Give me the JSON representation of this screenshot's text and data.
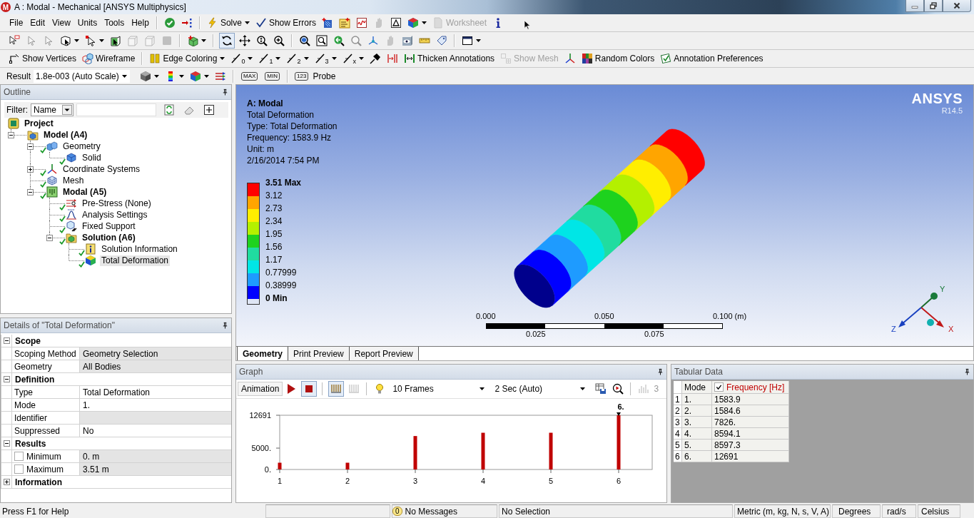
{
  "window": {
    "icon_label": "M",
    "title": "A : Modal - Mechanical [ANSYS Multiphysics]"
  },
  "menu": [
    "File",
    "Edit",
    "View",
    "Units",
    "Tools",
    "Help"
  ],
  "toolbar_1": [
    {
      "disabled": false
    },
    {
      "disabled": false
    },
    {
      "label": "Solve",
      "disabled": false
    },
    {
      "label": "Show Errors",
      "disabled": false
    },
    {
      "disabled": false
    },
    {
      "disabled": false
    },
    {
      "disabled": false
    },
    {
      "disabled": true
    },
    {
      "disabled": false
    },
    {
      "disabled": false
    },
    {
      "label": "Worksheet",
      "disabled": true
    },
    {
      "disabled": false
    }
  ],
  "toolbar_2": [
    {
      "disabled": false,
      "pressed": false
    },
    {
      "disabled": true,
      "pressed": false
    },
    {
      "disabled": true,
      "pressed": false
    },
    {
      "disabled": false,
      "pressed": false
    },
    {
      "disabled": false,
      "pressed": false
    },
    {
      "disabled": false,
      "pressed": false
    },
    {
      "disabled": true,
      "pressed": false
    },
    {
      "disabled": true,
      "pressed": false
    },
    {
      "disabled": true,
      "pressed": false
    },
    {
      "disabled": false,
      "pressed": false
    },
    {
      "disabled": false,
      "pressed": true
    },
    {
      "disabled": false,
      "pressed": false
    },
    {
      "disabled": false,
      "pressed": false
    },
    {
      "disabled": false,
      "pressed": false
    },
    {
      "disabled": false,
      "pressed": false
    },
    {
      "disabled": false,
      "pressed": false
    },
    {
      "disabled": false,
      "pressed": false
    },
    {
      "disabled": true,
      "pressed": false
    },
    {
      "disabled": false,
      "pressed": false
    },
    {
      "disabled": true,
      "pressed": false
    },
    {
      "disabled": false,
      "pressed": false
    },
    {
      "disabled": false,
      "pressed": false
    },
    {
      "disabled": false,
      "pressed": false
    },
    {
      "disabled": false,
      "pressed": false
    }
  ],
  "toolbar_3": [
    {
      "label": "Show Vertices",
      "disabled": false
    },
    {
      "label": "Wireframe",
      "disabled": false
    },
    {
      "label": "Edge Coloring",
      "disabled": false
    },
    {
      "label": "0",
      "disabled": false
    },
    {
      "label": "1",
      "disabled": false
    },
    {
      "label": "2",
      "disabled": false
    },
    {
      "label": "3",
      "disabled": false
    },
    {
      "label": "x",
      "disabled": false
    },
    {
      "disabled": false
    },
    {
      "disabled": false
    },
    {
      "label": "Thicken Annotations",
      "disabled": false
    },
    {
      "label": "Show Mesh",
      "disabled": true
    },
    {
      "disabled": false
    },
    {
      "label": "Random Colors",
      "disabled": false
    },
    {
      "label": "Annotation Preferences",
      "disabled": false
    }
  ],
  "result_toolbar": {
    "label": "Result",
    "scale": "1.8e-003 (Auto Scale)",
    "buttons": [
      {
        "disabled": false
      },
      {
        "disabled": false
      },
      {
        "disabled": false
      },
      {
        "disabled": false
      }
    ],
    "max": "MAX",
    "min": "MIN",
    "probe_badge": "123",
    "probe": "Probe"
  },
  "outline": {
    "title": "Outline",
    "filter_label": "Filter:",
    "filter_value": "Name",
    "tree": [
      {
        "label": "Project",
        "kind": "project",
        "ok": false,
        "selected": false,
        "children": [
          {
            "label": "Model (A4)",
            "kind": "model",
            "expanded": true,
            "ok": false,
            "selected": false,
            "children": [
              {
                "label": "Geometry",
                "kind": "geometry",
                "expanded": true,
                "ok": true,
                "selected": false,
                "children": [
                  {
                    "label": "Solid",
                    "kind": "body",
                    "ok": true,
                    "selected": false
                  }
                ]
              },
              {
                "label": "Coordinate Systems",
                "kind": "coordinates",
                "expanded": false,
                "ok": true,
                "selected": false
              },
              {
                "label": "Mesh",
                "kind": "mesh",
                "ok": true,
                "selected": false
              },
              {
                "label": "Modal (A5)",
                "kind": "analysis",
                "expanded": true,
                "ok": true,
                "selected": false,
                "children": [
                  {
                    "label": "Pre-Stress (None)",
                    "kind": "prestress",
                    "ok": true,
                    "selected": false
                  },
                  {
                    "label": "Analysis Settings",
                    "kind": "settings",
                    "ok": true,
                    "selected": false
                  },
                  {
                    "label": "Fixed Support",
                    "kind": "support",
                    "ok": true,
                    "selected": false
                  },
                  {
                    "label": "Solution (A6)",
                    "kind": "solution",
                    "expanded": true,
                    "ok": true,
                    "selected": false,
                    "children": [
                      {
                        "label": "Solution Information",
                        "kind": "info",
                        "ok": true,
                        "selected": false
                      },
                      {
                        "label": "Total Deformation",
                        "kind": "result",
                        "ok": true,
                        "selected": true
                      }
                    ]
                  }
                ]
              }
            ]
          }
        ]
      }
    ]
  },
  "details": {
    "title": "Details of \"Total Deformation\"",
    "groups": [
      {
        "label": "Scope",
        "expanded": true,
        "rows": [
          {
            "name": "Scoping Method",
            "value": "Geometry Selection",
            "readonly": true
          },
          {
            "name": "Geometry",
            "value": "All Bodies",
            "readonly": true
          }
        ]
      },
      {
        "label": "Definition",
        "expanded": true,
        "rows": [
          {
            "name": "Type",
            "value": "Total Deformation",
            "readonly": false
          },
          {
            "name": "Mode",
            "value": "1.",
            "readonly": false
          },
          {
            "name": "Identifier",
            "readonly": true
          },
          {
            "name": "Suppressed",
            "value": "No",
            "readonly": false
          }
        ]
      },
      {
        "label": "Results",
        "expanded": true,
        "rows": [
          {
            "name": "Minimum",
            "value": "0. m",
            "readonly": true,
            "checked": false
          },
          {
            "name": "Maximum",
            "value": "3.51 m",
            "readonly": true,
            "checked": false
          }
        ]
      },
      {
        "label": "Information",
        "expanded": false
      }
    ]
  },
  "viewport": {
    "title": "A: Modal",
    "info": [
      "Total Deformation",
      "Type: Total Deformation",
      "Frequency: 1583.9 Hz",
      "Unit: m",
      "2/16/2014 7:54 PM"
    ],
    "legend": {
      "labels": [
        "3.51 Max",
        "3.12",
        "2.73",
        "2.34",
        "1.95",
        "1.56",
        "1.17",
        "0.77999",
        "0.38999",
        "0 Min"
      ],
      "bands": [
        {
          "color": "#ff0000"
        },
        {
          "color": "#ffa500"
        },
        {
          "color": "#ffee00"
        },
        {
          "color": "#b4f000"
        },
        {
          "color": "#1ed21e"
        },
        {
          "color": "#20dca0"
        },
        {
          "color": "#00e6e6"
        },
        {
          "color": "#1e9bff"
        },
        {
          "color": "#0000ff"
        }
      ]
    },
    "logo": "ANSYS",
    "version": "R14.5",
    "scale_bar": {
      "upper": [
        "0.000",
        "0.050",
        "0.100 (m)"
      ],
      "lower": [
        "0.025",
        "0.075"
      ]
    },
    "triad": {
      "x": "X",
      "y": "Y",
      "z": "Z"
    },
    "tabs": [
      {
        "label": "Geometry",
        "selected": true
      },
      {
        "label": "Print Preview",
        "selected": false
      },
      {
        "label": "Report Preview",
        "selected": false
      }
    ]
  },
  "graph": {
    "title": "Graph",
    "toolbar": {
      "label": "Animation",
      "buttons": [
        {
          "disabled": false,
          "pressed": false
        },
        {
          "disabled": false,
          "pressed": true
        },
        {
          "disabled": false,
          "pressed": true
        },
        {
          "disabled": true,
          "pressed": false
        },
        {
          "disabled": false,
          "pressed": false
        },
        {
          "disabled": false,
          "pressed": false
        },
        {
          "disabled": false,
          "pressed": false
        },
        {
          "disabled": true,
          "pressed": false
        }
      ],
      "frames": "10 Frames",
      "duration": "2 Sec (Auto)",
      "count": "3"
    },
    "chart_data": {
      "type": "bar",
      "categories": [
        "1",
        "2",
        "3",
        "4",
        "5",
        "6"
      ],
      "values": [
        1583.9,
        1584.6,
        7826,
        8594.1,
        8597.3,
        12691
      ],
      "color": "#c00000",
      "ylim": [
        0,
        12691
      ],
      "yticks": [
        {
          "value": 0,
          "label": "0."
        },
        {
          "value": 5000,
          "label": "5000."
        },
        {
          "value": 12691,
          "label": "12691"
        }
      ],
      "annotations": [
        "6."
      ]
    }
  },
  "tabular": {
    "title": "Tabular Data",
    "columns": [
      {
        "label": "Mode"
      },
      {
        "label": "Frequency [Hz]",
        "checked": true
      }
    ],
    "rows": [
      {
        "index": "1",
        "cells": [
          "1.",
          "1583.9"
        ]
      },
      {
        "index": "2",
        "cells": [
          "2.",
          "1584.6"
        ]
      },
      {
        "index": "3",
        "cells": [
          "3.",
          "7826."
        ]
      },
      {
        "index": "4",
        "cells": [
          "4.",
          "8594.1"
        ]
      },
      {
        "index": "5",
        "cells": [
          "5.",
          "8597.3"
        ]
      },
      {
        "index": "6",
        "cells": [
          "6.",
          "12691"
        ]
      }
    ]
  },
  "status_bar": {
    "help": "Press F1 for Help",
    "message_count": "0",
    "messages": "No Messages",
    "selection": "No Selection",
    "units": "Metric (m, kg, N, s, V, A)",
    "angle": "Degrees",
    "angular_velocity": "rad/s",
    "temperature": "Celsius"
  }
}
